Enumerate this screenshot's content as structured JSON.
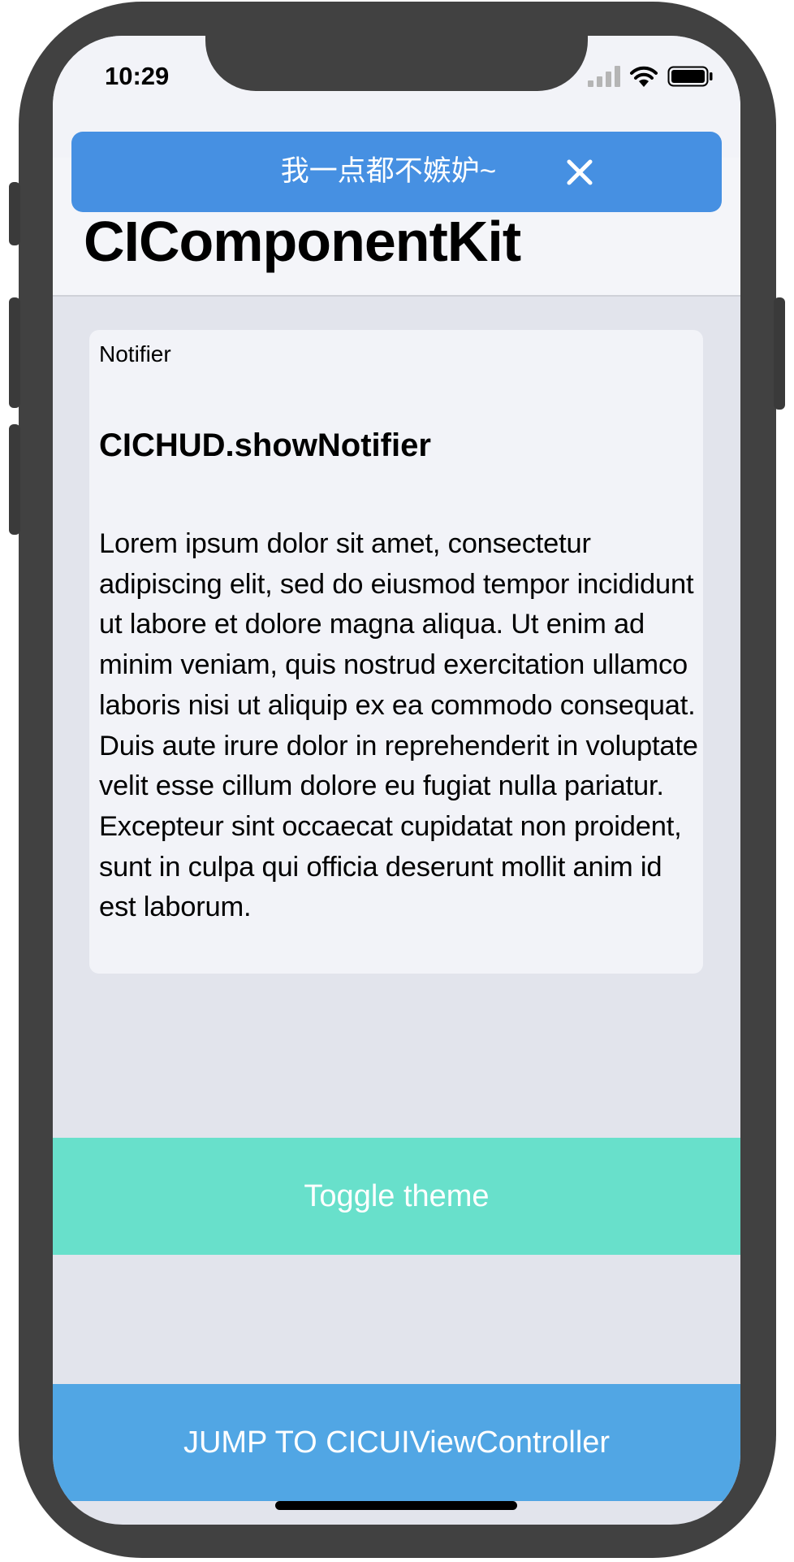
{
  "status_bar": {
    "time": "10:29"
  },
  "navigation": {
    "large_title": "CIComponentKit"
  },
  "notifier": {
    "message": "我一点都不嫉妒~"
  },
  "card": {
    "tag": "Notifier",
    "title": "CICHUD.showNotifier",
    "body": "Lorem ipsum dolor sit amet, consectetur adipiscing elit, sed do eiusmod tempor incididunt ut labore et dolore magna aliqua. Ut enim ad minim veniam, quis nostrud exercitation ullamco laboris nisi ut aliquip ex ea commodo consequat. Duis aute irure dolor in reprehenderit in voluptate velit esse cillum dolore eu fugiat nulla pariatur. Excepteur sint occaecat cupidatat non proident, sunt in culpa qui officia deserunt mollit anim id est laborum."
  },
  "buttons": {
    "toggle_theme": "Toggle theme",
    "jump": "JUMP TO CICUIViewController"
  },
  "colors": {
    "notifier_bg": "#4690e2",
    "toggle_bg": "#68e0cb",
    "jump_bg": "#51a6e4",
    "screen_bg": "#e2e4ec",
    "frame": "#414141"
  }
}
